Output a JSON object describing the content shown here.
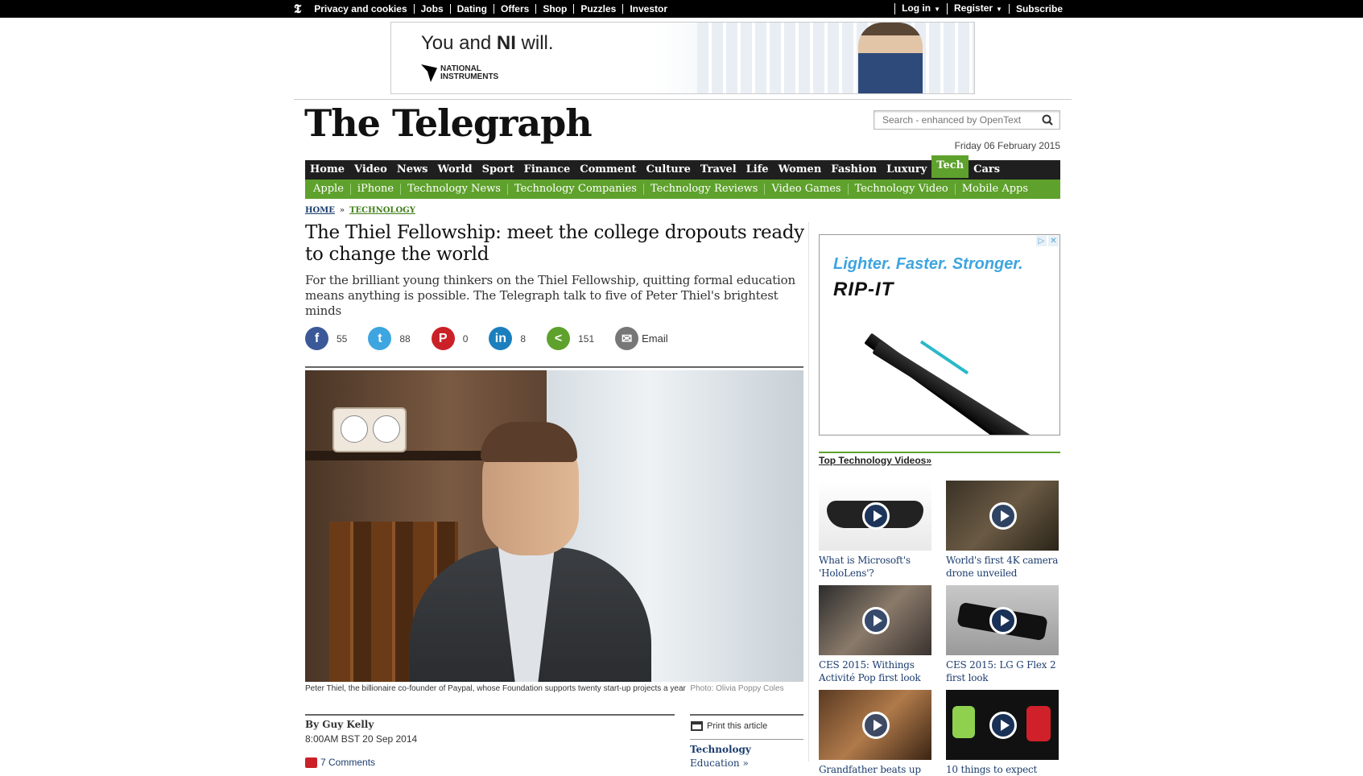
{
  "topbar": {
    "logo": "𝕿",
    "links": [
      "Privacy and cookies",
      "Jobs",
      "Dating",
      "Offers",
      "Shop",
      "Puzzles",
      "Investor"
    ],
    "login": "Log in",
    "register": "Register",
    "subscribe": "Subscribe"
  },
  "top_ad": {
    "tagline_pre": "You and ",
    "tagline_bold": "NI",
    "tagline_post": " will.",
    "brand_line1": "NATIONAL",
    "brand_line2": "INSTRUMENTS"
  },
  "masthead": {
    "logo": "The Telegraph",
    "search_placeholder": "Search - enhanced by OpenText",
    "date": "Friday 06 February 2015"
  },
  "nav_primary": [
    "Home",
    "Video",
    "News",
    "World",
    "Sport",
    "Finance",
    "Comment",
    "Culture",
    "Travel",
    "Life",
    "Women",
    "Fashion",
    "Luxury",
    "Tech",
    "Cars"
  ],
  "nav_primary_active": "Tech",
  "nav_secondary": [
    "Apple",
    "iPhone",
    "Technology News",
    "Technology Companies",
    "Technology Reviews",
    "Video Games",
    "Technology Video",
    "Mobile Apps"
  ],
  "breadcrumb": {
    "home": "HOME",
    "sep": "»",
    "section": "TECHNOLOGY"
  },
  "article": {
    "headline": "The Thiel Fellowship: meet the college dropouts ready to change the world",
    "standfirst": "For the brilliant young thinkers on the Thiel Fellowship, quitting formal education means anything is possible. The Telegraph talk to five of Peter Thiel's brightest minds",
    "caption": "Peter Thiel, the billionaire co-founder of Paypal, whose Foundation supports twenty start-up projects a year",
    "credit": "Photo: Olivia Poppy Coles",
    "author": "By Guy Kelly",
    "published": "8:00AM BST 20 Sep 2014",
    "comments": "7 Comments",
    "print": "Print this article",
    "section": "Technology",
    "subsection": "Education »"
  },
  "share": {
    "facebook": {
      "icon": "f",
      "count": "55"
    },
    "twitter": {
      "icon": "t",
      "count": "88"
    },
    "pinterest": {
      "icon": "P",
      "count": "0"
    },
    "linkedin": {
      "icon": "in",
      "count": "8"
    },
    "share": {
      "icon": "<",
      "count": "151"
    },
    "email": {
      "icon": "✉",
      "label": "Email"
    }
  },
  "side_ad": {
    "slogan": "Lighter. Faster. Stronger.",
    "brand": "RIP-IT",
    "adchoices": [
      "▷",
      "✕"
    ]
  },
  "videos": {
    "heading": "Top Technology Videos»",
    "items": [
      {
        "title": "What is Microsoft's 'HoloLens'?"
      },
      {
        "title": "World's first 4K camera drone unveiled"
      },
      {
        "title": "CES 2015: Withings Activité Pop first look"
      },
      {
        "title": "CES 2015: LG G Flex 2 first look"
      },
      {
        "title": "Grandfather beats up"
      },
      {
        "title": "10 things to expect"
      }
    ]
  },
  "colors": {
    "tech_green": "#5ea12c",
    "nav_dark": "#1f1f1f",
    "link_blue": "#1c3d6e"
  }
}
